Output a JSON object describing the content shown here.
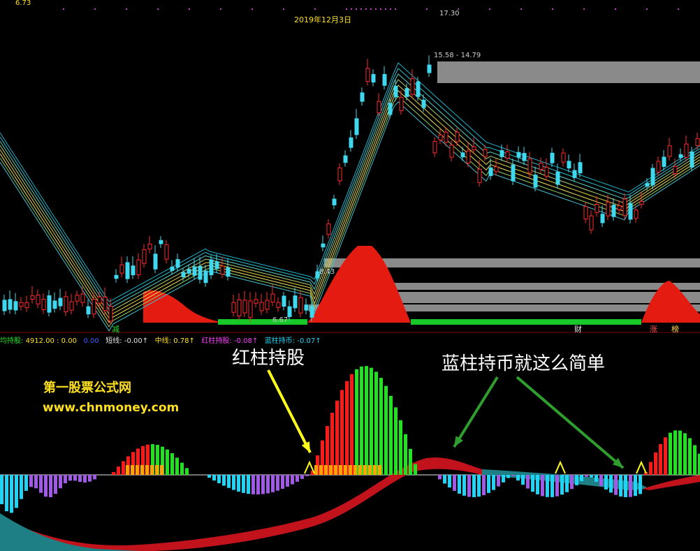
{
  "chart_data": [
    {
      "type": "candlestick",
      "panel": "price",
      "top_value_label": "6.73",
      "date_label": "2019年12月3日",
      "high_label": "17.30",
      "range_label": "15.58 - 14.79",
      "mid_label": "8.43",
      "low_label": "6.67",
      "signal_labels": [
        "减",
        "财",
        "涨",
        "榜"
      ],
      "red_area_peak_note": "",
      "colors": {
        "up": "#ff2a2a",
        "down": "#3fd8ee",
        "ribbon_green": "#18c828",
        "area_red": "#e41b10",
        "resistance_bar": "#8a8a8a"
      }
    },
    {
      "type": "histogram",
      "panel": "indicator",
      "legend": {
        "prefix": "均持股:",
        "v1": "4912.00",
        "sep1": ":",
        "v2": "0.00",
        "v3": "0.00",
        "short_label": "短线:",
        "short_val": "-0.00↑",
        "mid_label": "中线:",
        "mid_val": "0.78↑",
        "red_label": "红柱持股:",
        "red_val": "-0.08↑",
        "blue_label": "蓝柱持币:",
        "blue_val": "-0.07↑"
      },
      "annotations": {
        "red_hold": "红柱持股",
        "blue_hold": "蓝柱持币就这么简单",
        "site_name": "第一股票公式网",
        "site_url": "www.chnmoney.com"
      },
      "colors": {
        "bar_green": "#22e022",
        "bar_red": "#ff1a1a",
        "bar_orange": "#ffa400",
        "bar_cyan": "#21d4f5",
        "bar_purple": "#a05ae6",
        "band_red": "#c2121b",
        "band_teal": "#1e7f84",
        "arrow_yellow": "#ffff1a",
        "arrow_green": "#2e9e2e"
      }
    }
  ]
}
